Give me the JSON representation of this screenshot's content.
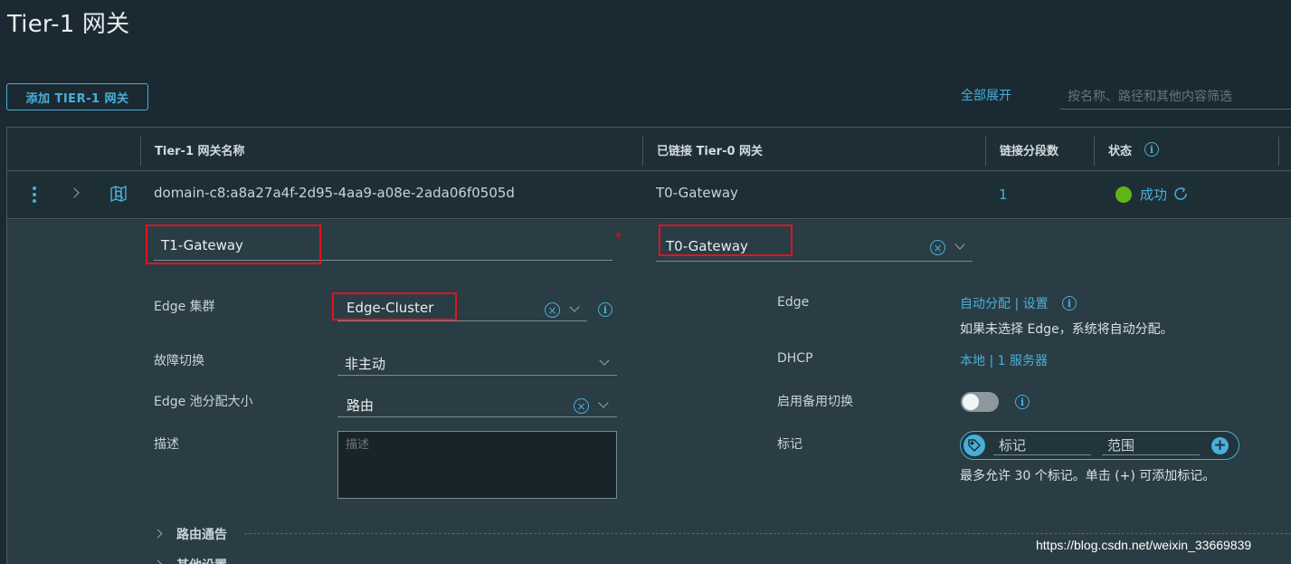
{
  "page": {
    "title": "Tier-1 网关"
  },
  "toolbar": {
    "add_button": "添加 TIER-1 网关",
    "expand_all": "全部展开",
    "filter_placeholder": "按名称、路径和其他内容筛选"
  },
  "table": {
    "columns": {
      "name": "Tier-1 网关名称",
      "linked_tier0": "已链接 Tier-0 网关",
      "segments": "链接分段数",
      "status": "状态"
    },
    "rows": [
      {
        "name": "domain-c8:a8a27a4f-2d95-4aa9-a08e-2ada06f0505d",
        "linked_tier0": "T0-Gateway",
        "segments": "1",
        "status": "成功"
      }
    ]
  },
  "form": {
    "name_value": "T1-Gateway",
    "tier0_value": "T0-Gateway",
    "edge_cluster": {
      "label": "Edge 集群",
      "value": "Edge-Cluster"
    },
    "failover": {
      "label": "故障切换",
      "value": "非主动"
    },
    "pool_size": {
      "label": "Edge 池分配大小",
      "value": "路由"
    },
    "description": {
      "label": "描述",
      "placeholder": "描述"
    },
    "edge": {
      "label": "Edge",
      "link_auto": "自动分配",
      "link_separator": " | ",
      "link_settings": "设置",
      "hint": "如果未选择 Edge，系统将自动分配。"
    },
    "dhcp": {
      "label": "DHCP",
      "value": "本地 | 1 服务器"
    },
    "standby_relocation": {
      "label": "启用备用切换"
    },
    "tags": {
      "label": "标记",
      "tag_placeholder": "标记",
      "scope_placeholder": "范围",
      "hint": "最多允许 30 个标记。单击 (+) 可添加标记。"
    },
    "sections": [
      "路由通告",
      "其他设置"
    ]
  },
  "colors": {
    "accent": "#49afd9",
    "success": "#60b515",
    "required": "#e0141e"
  },
  "watermark": "https://blog.csdn.net/weixin_33669839"
}
